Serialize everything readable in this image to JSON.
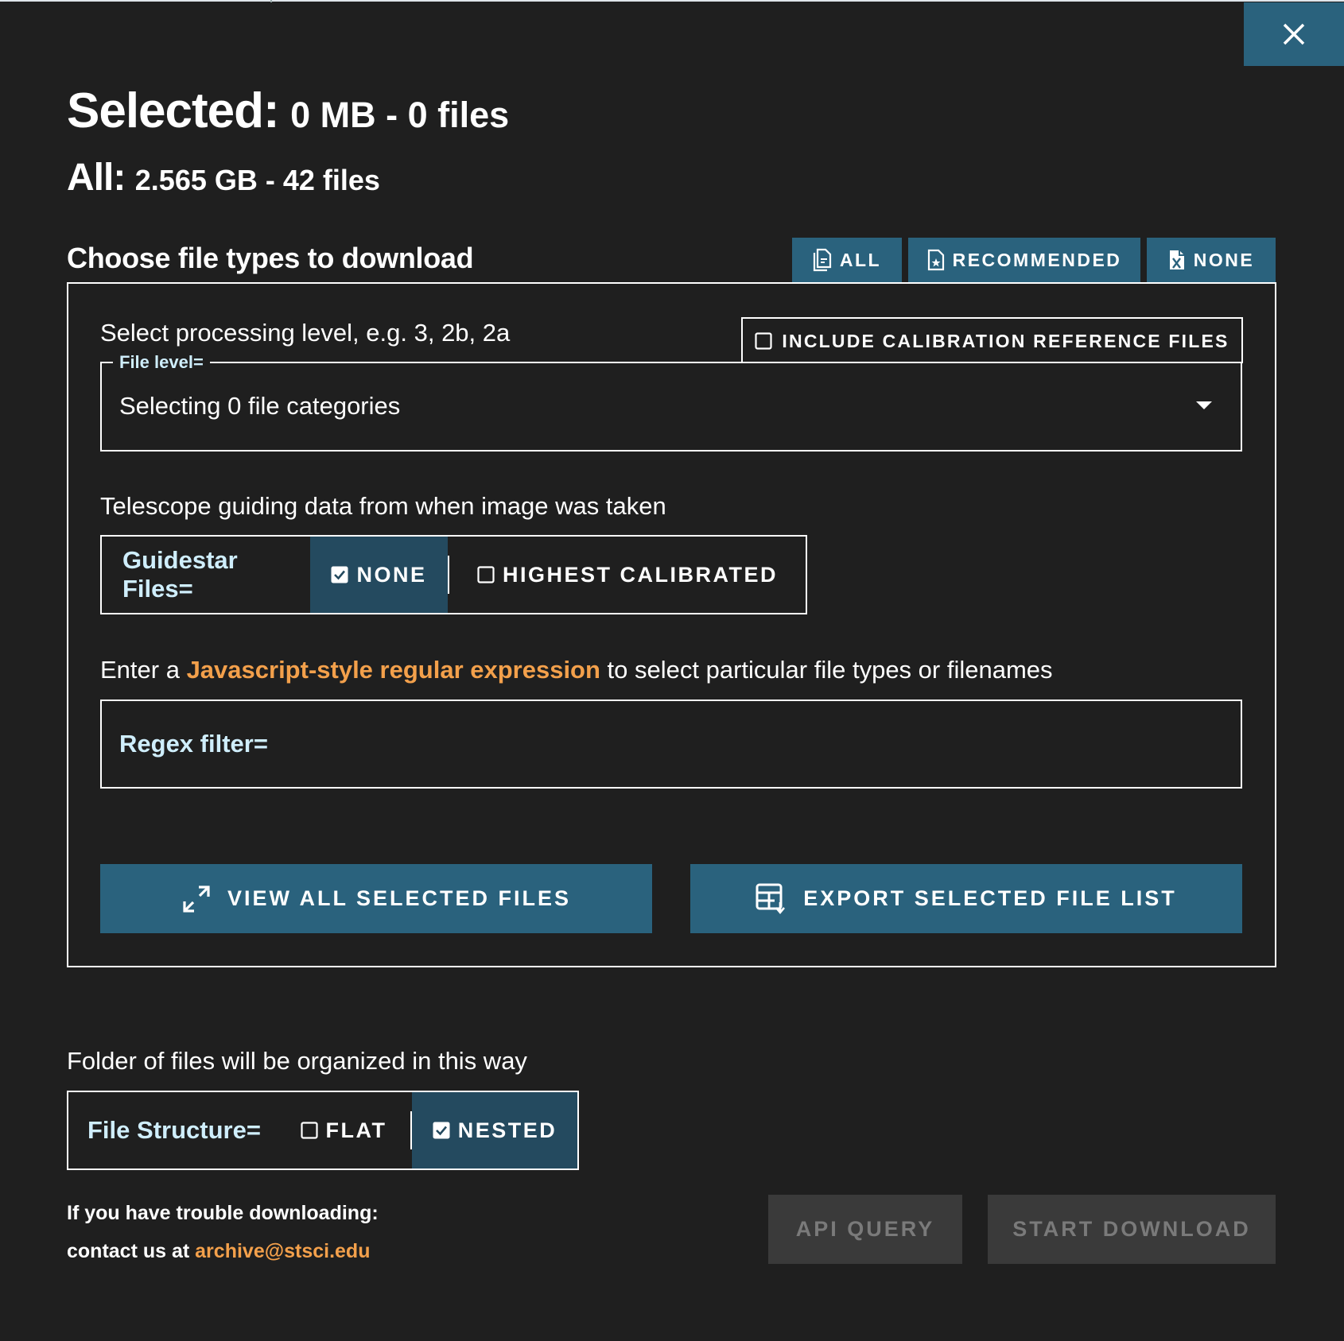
{
  "header": {
    "selected_label": "Selected:",
    "selected_value": "0 MB - 0 files",
    "all_label": "All:",
    "all_value": "2.565 GB - 42 files",
    "close_icon": "close-icon"
  },
  "file_types": {
    "title": "Choose file types to download",
    "presets": [
      {
        "label": "ALL",
        "icon": "file-copy-icon"
      },
      {
        "label": "RECOMMENDED",
        "icon": "file-star-icon"
      },
      {
        "label": "NONE",
        "icon": "file-x-icon"
      }
    ],
    "processing_hint": "Select processing level, e.g. 3, 2b, 2a",
    "calibration_checkbox": {
      "label": "INCLUDE CALIBRATION REFERENCE FILES",
      "checked": false
    },
    "file_level": {
      "legend": "File level=",
      "value": "Selecting 0 file categories"
    },
    "guide_hint": "Telescope guiding data from when image was taken",
    "guidestar": {
      "label": "Guidestar Files=",
      "options": [
        {
          "label": "NONE",
          "checked": true
        },
        {
          "label": "HIGHEST CALIBRATED",
          "checked": false
        }
      ]
    },
    "regex_hint": {
      "prefix": "Enter a ",
      "link": "Javascript-style regular expression",
      "suffix": " to select particular file types or filenames"
    },
    "regex_filter": {
      "label": "Regex filter=",
      "value": ""
    },
    "actions": {
      "view_all": "VIEW ALL SELECTED FILES",
      "export_list": "EXPORT SELECTED FILE LIST"
    }
  },
  "structure": {
    "hint": "Folder of files will be organized in this way",
    "label": "File Structure=",
    "options": [
      {
        "label": "FLAT",
        "checked": false
      },
      {
        "label": "NESTED",
        "checked": true
      }
    ]
  },
  "footer": {
    "trouble_line1": "If you have trouble downloading:",
    "trouble_line2_prefix": "contact us at ",
    "email": "archive@stsci.edu",
    "api_query": "API QUERY",
    "start_download": "START DOWNLOAD"
  },
  "colors": {
    "background": "#1f1f1f",
    "accent": "#2a627d",
    "active_segment": "#244a5f",
    "label_light_blue": "#cfeefc",
    "link_orange": "#f3a04b",
    "disabled_bg": "#3a3a3a",
    "disabled_text": "#7a7a7a"
  }
}
